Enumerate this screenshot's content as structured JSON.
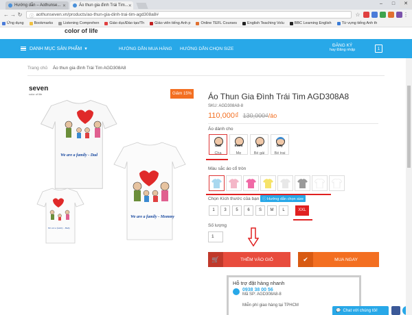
{
  "browser": {
    "tabs": [
      {
        "label": "Hướng dẫn – Aothunse..."
      },
      {
        "label": "Áo thun gia đình Trái Tim..."
      }
    ],
    "url": "aothunseven.vn/products/ao-thun-gia-dinh-trai-tim-agd308a8#",
    "bookmarks": [
      "Ứng dụng",
      "Bookmarks",
      "Listening Comprehen",
      "Giáo dục/Đào tạo/Th",
      "Giáo viên tiếng Anh p",
      "Online TEFL Courses",
      "English Teaching Volu",
      "BBC Learning English",
      "Từ vựng tiếng Anh th"
    ]
  },
  "site": {
    "logo_text": "color of life",
    "menu_label": "DANH MỤC SẢN PHẨM",
    "nav": [
      "HƯỚNG DẪN MUA HÀNG",
      "HƯỚNG DẪN CHỌN SIZE"
    ],
    "register": "ĐĂNG KÝ",
    "login": "hay Đăng nhập",
    "cart_count": "1"
  },
  "breadcrumb": {
    "home": "Trang chủ",
    "current": "Áo thun gia đình Trái Tim AGD308A8"
  },
  "gallery": {
    "brand": "seven",
    "brand_sub": "color of life",
    "shirt_texts": [
      "We are a family - Dad",
      "We are a family - Mommy",
      "We are a family - Baby"
    ]
  },
  "product": {
    "sale_badge": "Giảm 15%",
    "title": "Áo Thun Gia Đình Trái Tim AGD308A8",
    "sku": "SKU: AGD308A8-8",
    "price": "110,000₫",
    "old_price": "130,000₫",
    "price_unit": "/áo",
    "fit_label": "Áo dành cho",
    "fit_options": [
      {
        "tag": "dad",
        "label": "Cha"
      },
      {
        "tag": "mom",
        "label": "Mẹ"
      },
      {
        "tag": "girl",
        "label": "Bé gái"
      },
      {
        "tag": "boy",
        "label": "Bé trai"
      }
    ],
    "color_label": "Màu sắc áo cổ tròn",
    "colors": [
      "#a8d8ef",
      "#f4b7c8",
      "#f06aa6",
      "#f6e36a",
      "#e8e8e8",
      "#9a9a9a",
      "#ffffff",
      "#ffffff"
    ],
    "size_label": "Chọn Kích thước của bạn",
    "size_guide": "Hướng dẫn chọn size",
    "sizes": [
      "1",
      "3",
      "5",
      "6",
      "S",
      "M",
      "L",
      "XXL"
    ],
    "qty_label": "Số lượng",
    "qty": "1",
    "add_to_cart": "THÊM VÀO GIỎ",
    "buy_now": "MUA NGAY"
  },
  "support": {
    "heading": "Hỗ trợ đặt hàng nhanh",
    "phone": "0938 38 00 56",
    "sku_line": "Mã SP: AGD308A8-8",
    "shipping": "Miễn phí giao hàng tại TPHCM"
  },
  "chat": {
    "label": "Chat với chúng tôi!"
  }
}
